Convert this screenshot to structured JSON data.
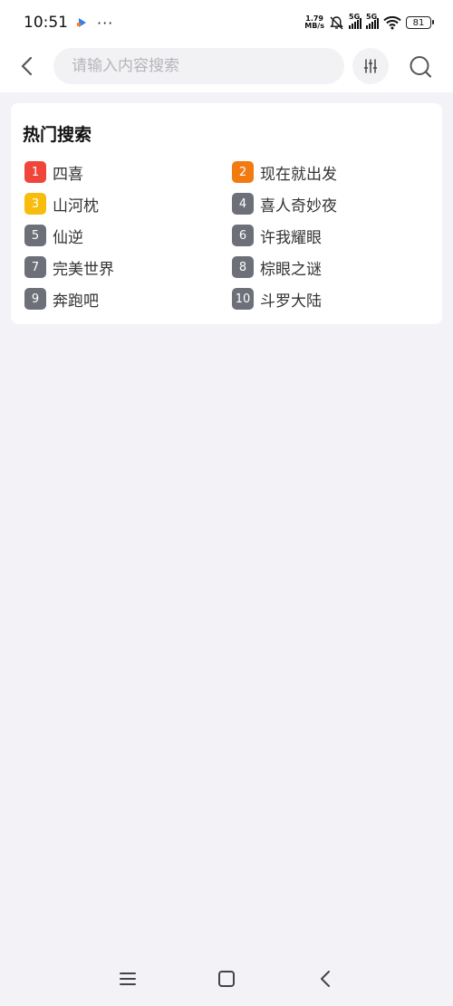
{
  "status_bar": {
    "time": "10:51",
    "more": "···",
    "net_speed_value": "1.79",
    "net_speed_unit": "MB/s",
    "sim1_label": "5G",
    "sim2_label": "5G",
    "battery": "81"
  },
  "search": {
    "placeholder": "请输入内容搜索",
    "value": ""
  },
  "hot_search": {
    "title": "热门搜索",
    "items": [
      {
        "rank": "1",
        "text": "四喜",
        "color": "#f0453a"
      },
      {
        "rank": "2",
        "text": "现在就出发",
        "color": "#f27b11"
      },
      {
        "rank": "3",
        "text": "山河枕",
        "color": "#f8bc0d"
      },
      {
        "rank": "4",
        "text": "喜人奇妙夜",
        "color": "#6d7078"
      },
      {
        "rank": "5",
        "text": "仙逆",
        "color": "#6d7078"
      },
      {
        "rank": "6",
        "text": "许我耀眼",
        "color": "#6d7078"
      },
      {
        "rank": "7",
        "text": "完美世界",
        "color": "#6d7078"
      },
      {
        "rank": "8",
        "text": "棕眼之谜",
        "color": "#6d7078"
      },
      {
        "rank": "9",
        "text": "奔跑吧",
        "color": "#6d7078"
      },
      {
        "rank": "10",
        "text": "斗罗大陆",
        "color": "#6d7078"
      }
    ]
  },
  "icons": {
    "back": "chevron-left-icon",
    "filter": "sliders-icon",
    "search": "search-icon",
    "nav_menu": "menu-icon",
    "nav_home": "home-square-icon",
    "nav_back": "back-triangle-icon"
  }
}
